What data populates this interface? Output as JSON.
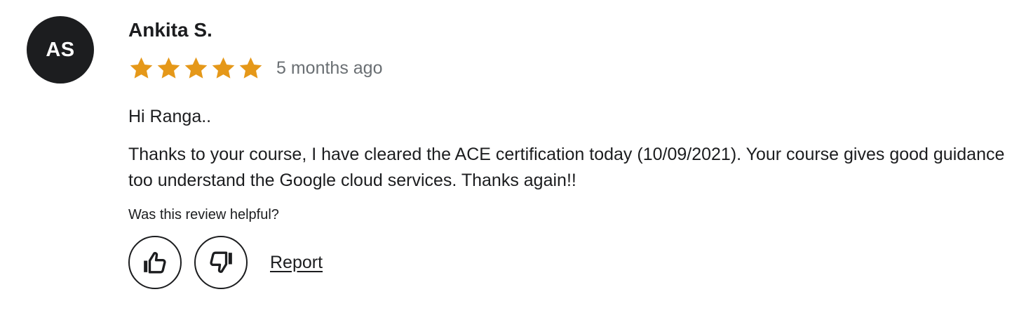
{
  "review": {
    "avatar_initials": "AS",
    "reviewer_name": "Ankita S.",
    "rating": 5,
    "rating_max": 5,
    "star_color": "#e59819",
    "time_ago": "5 months ago",
    "greeting": "Hi Ranga..",
    "body": "Thanks to your course, I have cleared the ACE certification today (10/09/2021). Your course gives good guidance too understand the Google cloud services. Thanks again!!",
    "helpful_prompt": "Was this review helpful?",
    "thumbs_up_icon": "thumbs-up-icon",
    "thumbs_down_icon": "thumbs-down-icon",
    "report_label": "Report"
  }
}
